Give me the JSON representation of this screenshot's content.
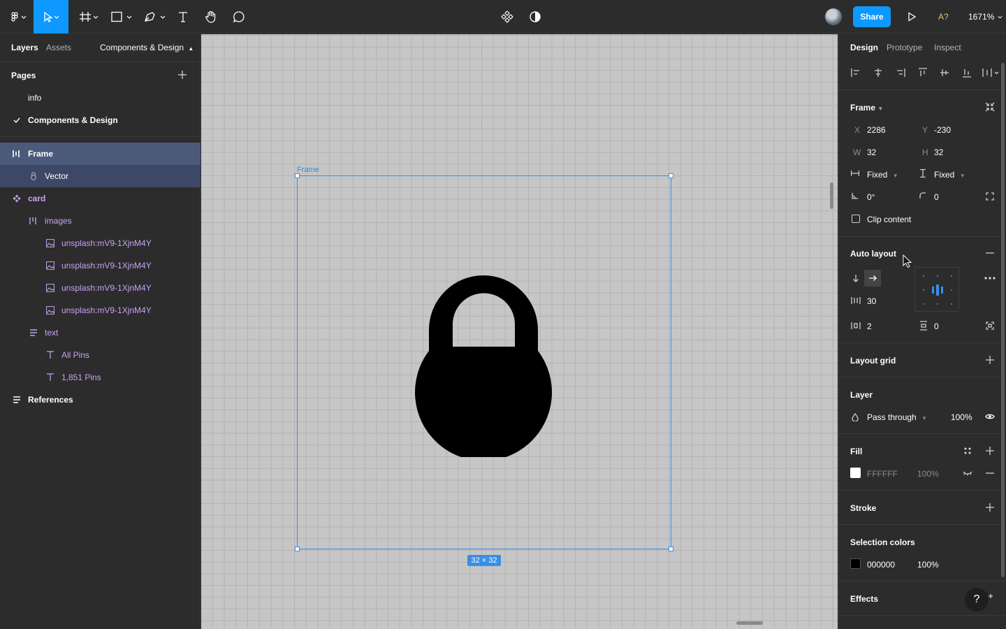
{
  "toolbar": {
    "share_label": "Share",
    "missing_fonts": "A?",
    "zoom": "1671%"
  },
  "left_panel": {
    "tabs": [
      "Layers",
      "Assets",
      "Components & Design"
    ],
    "pages_title": "Pages",
    "pages": [
      {
        "label": "info",
        "current": false
      },
      {
        "label": "Components & Design",
        "current": true
      }
    ],
    "layers": [
      {
        "label": "Frame",
        "icon": "auto-layout-icon",
        "indent": 0,
        "selected": true
      },
      {
        "label": "Vector",
        "icon": "lock-vector-icon",
        "indent": 1,
        "selected": true
      },
      {
        "label": "card",
        "icon": "component-icon",
        "indent": 0
      },
      {
        "label": "images",
        "icon": "auto-layout-icon",
        "indent": 1
      },
      {
        "label": "unsplash:mV9-1XjnM4Y",
        "icon": "image-icon",
        "indent": 2
      },
      {
        "label": "unsplash:mV9-1XjnM4Y",
        "icon": "image-icon",
        "indent": 2
      },
      {
        "label": "unsplash:mV9-1XjnM4Y",
        "icon": "image-icon",
        "indent": 2
      },
      {
        "label": "unsplash:mV9-1XjnM4Y",
        "icon": "image-icon",
        "indent": 2
      },
      {
        "label": "text",
        "icon": "list-icon",
        "indent": 1
      },
      {
        "label": "All Pins",
        "icon": "text-icon",
        "indent": 2
      },
      {
        "label": "1,851 Pins",
        "icon": "text-icon",
        "indent": 2
      },
      {
        "label": "References",
        "icon": "list-icon",
        "indent": 0
      }
    ]
  },
  "canvas": {
    "frame_label": "Frame",
    "size_badge": "32 × 32"
  },
  "right_panel": {
    "tabs": [
      "Design",
      "Prototype",
      "Inspect"
    ],
    "frame": {
      "title": "Frame",
      "x_label": "X",
      "x": "2286",
      "y_label": "Y",
      "y": "-230",
      "w_label": "W",
      "w": "32",
      "h_label": "H",
      "h": "32",
      "horizontal_resizing": "Fixed",
      "vertical_resizing": "Fixed",
      "rotation": "0°",
      "corner_radius": "0",
      "clip_content": "Clip content"
    },
    "auto_layout": {
      "title": "Auto layout",
      "spacing": "30",
      "horizontal_padding": "2",
      "vertical_padding": "0"
    },
    "layout_grid": {
      "title": "Layout grid"
    },
    "layer": {
      "title": "Layer",
      "blend_mode": "Pass through",
      "opacity": "100%"
    },
    "fill": {
      "title": "Fill",
      "hex": "FFFFFF",
      "opacity": "100%",
      "color": "#ffffff"
    },
    "stroke": {
      "title": "Stroke"
    },
    "selection_colors": {
      "title": "Selection colors",
      "hex": "000000",
      "opacity": "100%",
      "color": "#000000"
    },
    "effects": {
      "title": "Effects"
    }
  },
  "help_label": "?",
  "colors": {
    "accent": "#0d99ff",
    "selection_blue": "#3a8ee6",
    "component_purple": "#c7a2f5"
  }
}
